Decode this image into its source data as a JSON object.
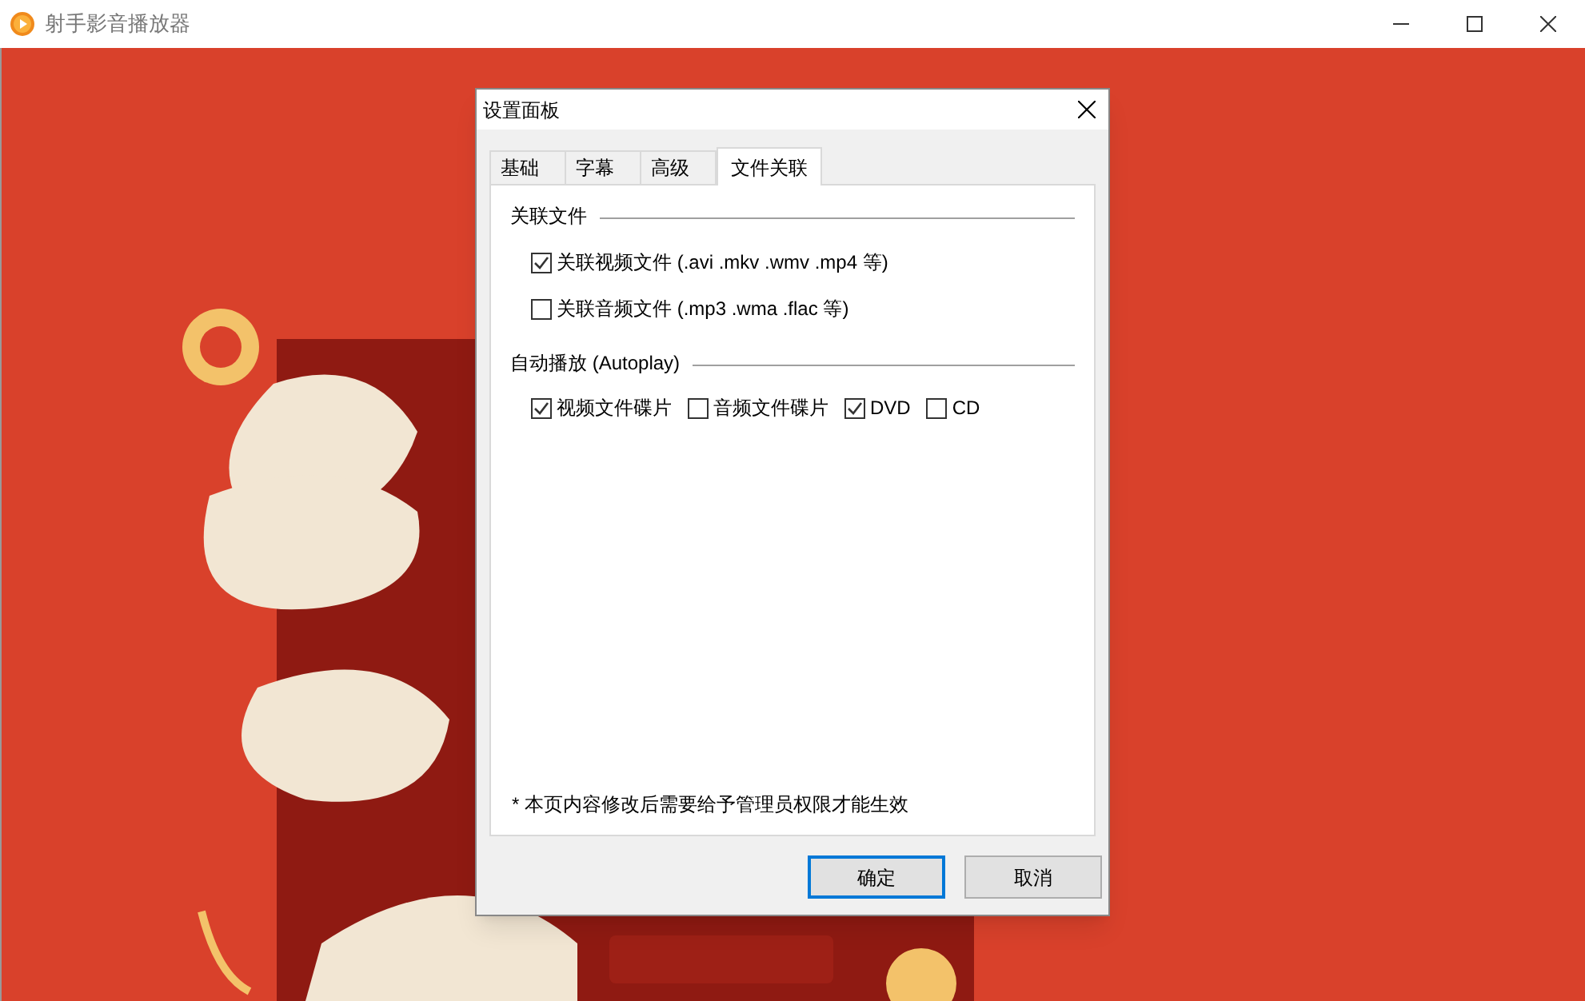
{
  "window": {
    "title": "射手影音播放器"
  },
  "dialog": {
    "title": "设置面板",
    "tabs": [
      {
        "label": "基础",
        "selected": false
      },
      {
        "label": "字幕",
        "selected": false
      },
      {
        "label": "高级",
        "selected": false
      },
      {
        "label": "文件关联",
        "selected": true
      }
    ],
    "sections": [
      {
        "title": "关联文件",
        "kind": "rows",
        "options": [
          {
            "label": "关联视频文件 (.avi .mkv .wmv .mp4 等)",
            "checked": true
          },
          {
            "label": "关联音频文件 (.mp3 .wma .flac 等)",
            "checked": false
          }
        ]
      },
      {
        "title": "自动播放 (Autoplay)",
        "kind": "inline",
        "options": [
          {
            "label": "视频文件碟片",
            "checked": true
          },
          {
            "label": "音频文件碟片",
            "checked": false
          },
          {
            "label": "DVD",
            "checked": true
          },
          {
            "label": "CD",
            "checked": false
          }
        ]
      }
    ],
    "note": "* 本页内容修改后需要给予管理员权限才能生效",
    "buttons": [
      {
        "label": "确定",
        "default": true
      },
      {
        "label": "取消",
        "default": false
      }
    ]
  }
}
